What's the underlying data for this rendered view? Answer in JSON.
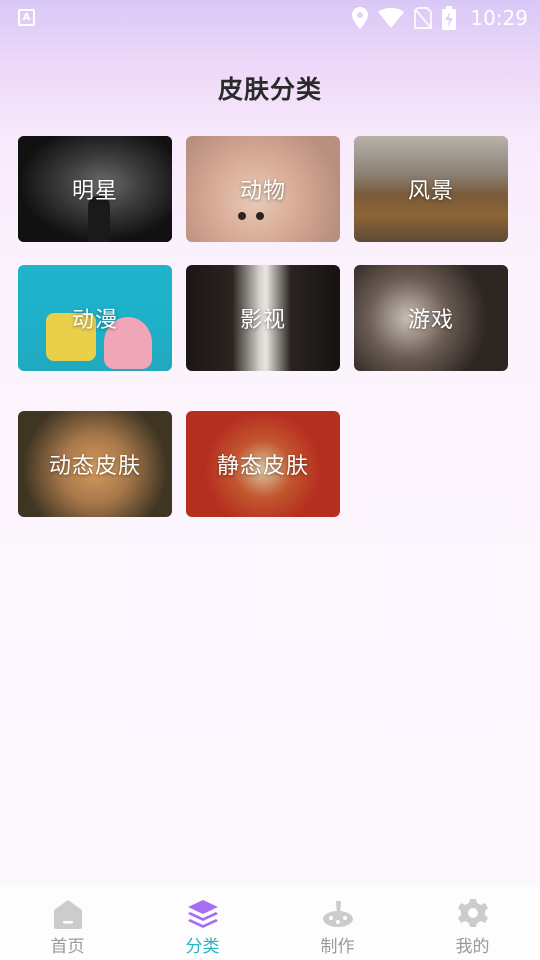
{
  "status_bar": {
    "app_badge": "A",
    "time": "10:29"
  },
  "page": {
    "title": "皮肤分类"
  },
  "categories": [
    {
      "label": "明星"
    },
    {
      "label": "动物"
    },
    {
      "label": "风景"
    },
    {
      "label": "动漫"
    },
    {
      "label": "影视"
    },
    {
      "label": "游戏"
    },
    {
      "label": "动态皮肤"
    },
    {
      "label": "静态皮肤"
    }
  ],
  "tab_bar": {
    "active": "分类",
    "tabs": [
      {
        "label": "首页",
        "icon": "home-icon"
      },
      {
        "label": "分类",
        "icon": "layers-icon"
      },
      {
        "label": "制作",
        "icon": "palette-icon"
      },
      {
        "label": "我的",
        "icon": "gear-icon"
      }
    ]
  },
  "colors": {
    "active_tab_text": "#27b3c3",
    "active_tab_icon": "#a86ef0",
    "inactive_tab": "#cccccc"
  }
}
